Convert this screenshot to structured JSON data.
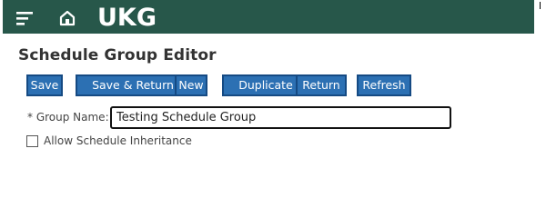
{
  "header": {
    "logo_text": "UKG",
    "background_color": "#27574a",
    "icons": [
      "menu-icon",
      "home-icon"
    ]
  },
  "page": {
    "title": "Schedule Group Editor"
  },
  "toolbar": {
    "button_color": "#2c70b3",
    "buttons": [
      {
        "label": "Save"
      },
      {
        "label": "Save & Return"
      },
      {
        "label": "New"
      },
      {
        "label": "Duplicate"
      },
      {
        "label": "Return"
      },
      {
        "label": "Refresh"
      }
    ]
  },
  "form": {
    "group_name_label": "* Group Name:",
    "group_name_value": "Testing Schedule Group",
    "allow_inheritance_label": "Allow Schedule Inheritance",
    "allow_inheritance_checked": false
  }
}
